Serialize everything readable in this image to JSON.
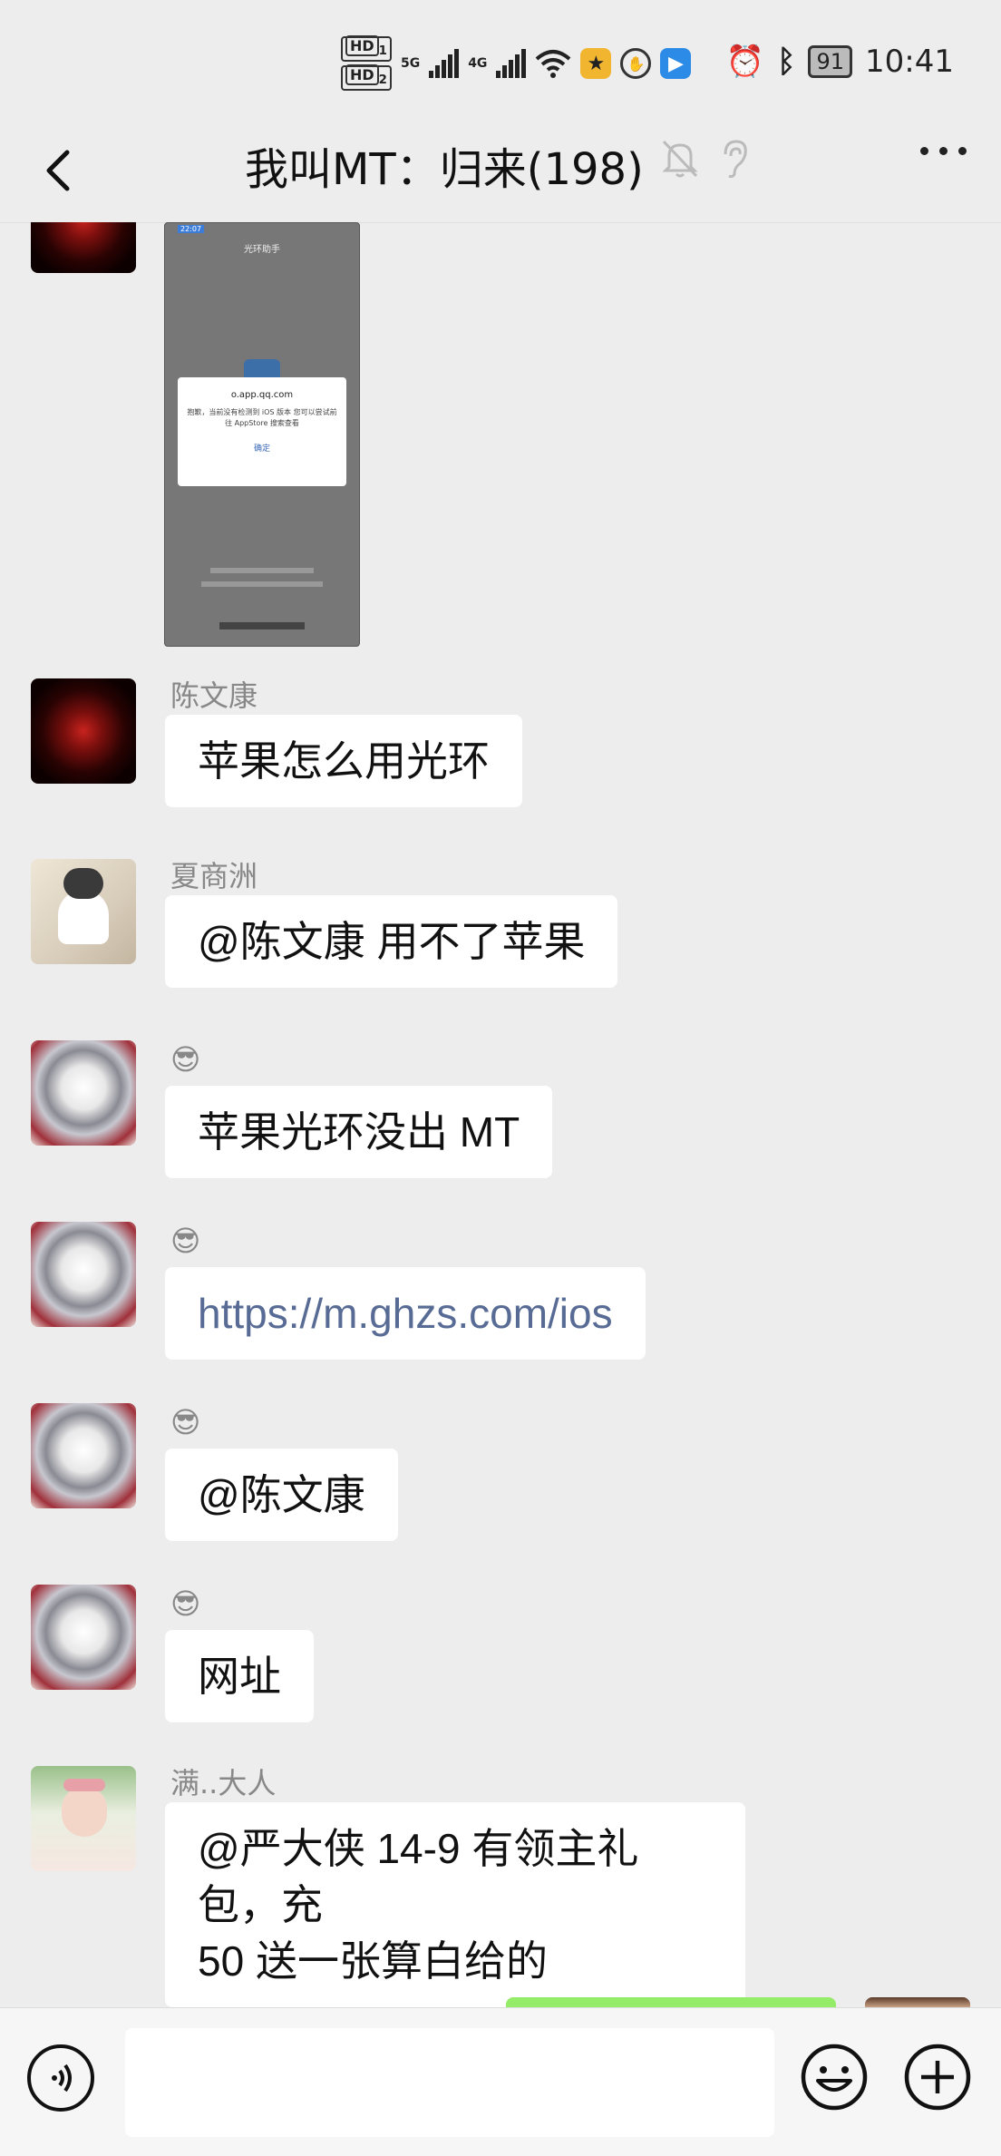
{
  "status_bar": {
    "hd1": "HD",
    "hd1_sub": "1",
    "hd2": "HD",
    "hd2_sub": "2",
    "net1": "5G",
    "net2": "4G",
    "battery": "91",
    "time": "10:41",
    "icons": [
      "signal-icon",
      "wifi-icon",
      "game-app-icon",
      "hand-app-icon",
      "arrow-app-icon",
      "alarm-icon",
      "bluetooth-icon",
      "battery-icon"
    ]
  },
  "header": {
    "title": "我叫MT：归来(198)",
    "icons": [
      "back-icon",
      "mute-bell-icon",
      "ear-icon",
      "more-icon"
    ]
  },
  "messages": [
    {
      "type": "image",
      "avatar": "rose-avatar",
      "screenshot": {
        "time": "22:07",
        "title": "光环助手",
        "dialog_title": "o.app.qq.com",
        "dialog_body": "抱歉，当前没有检测到 iOS 版本 您可以尝试前往 AppStore 搜索查看",
        "dialog_ok": "确定"
      }
    },
    {
      "type": "text",
      "sender": "陈文康",
      "avatar": "rose-avatar",
      "text": "苹果怎么用光环"
    },
    {
      "type": "text",
      "sender": "夏商洲",
      "avatar": "kid-avatar",
      "text": "@陈文康  用不了苹果"
    },
    {
      "type": "text",
      "sender": "😎",
      "avatar": "opera-avatar",
      "text": "苹果光环没出 MT"
    },
    {
      "type": "link",
      "sender": "😎",
      "avatar": "opera-avatar",
      "text": "https://m.ghzs.com/ios"
    },
    {
      "type": "text",
      "sender": "😎",
      "avatar": "opera-avatar",
      "text": "@陈文康"
    },
    {
      "type": "text",
      "sender": "😎",
      "avatar": "opera-avatar",
      "text": "网址"
    },
    {
      "type": "text",
      "sender": "满..大人",
      "avatar": "baby-avatar",
      "text": "@严大侠 14-9  有领主礼包，充\n50 送一张算白给的"
    }
  ],
  "input": {
    "placeholder": "",
    "icons": [
      "voice-icon",
      "emoji-icon",
      "plus-icon"
    ]
  },
  "colors": {
    "background": "#ededed",
    "bubble": "#ffffff",
    "sent_bubble": "#95ec69",
    "link": "#576b95",
    "sender": "#888888"
  }
}
